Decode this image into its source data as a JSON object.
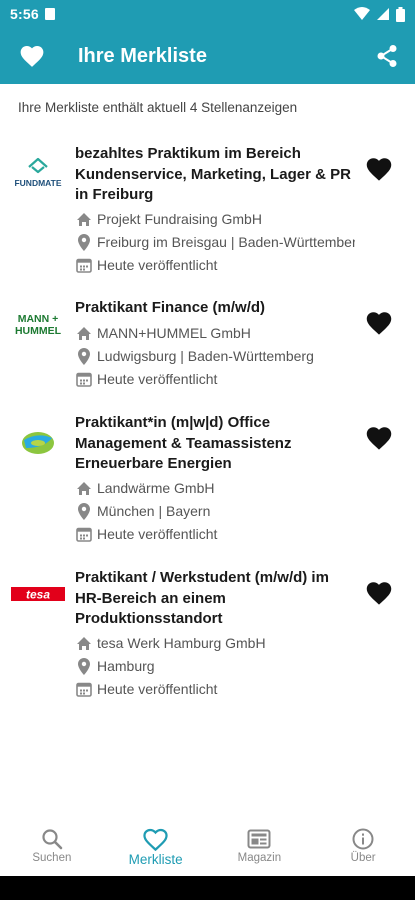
{
  "status": {
    "time": "5:56"
  },
  "app_bar": {
    "title": "Ihre Merkliste"
  },
  "summary": "Ihre Merkliste enthält aktuell 4 Stellenanzeigen",
  "jobs": [
    {
      "title": "bezahltes Praktikum im Bereich Kundenservice, Marketing, Lager & PR in Freiburg",
      "company": "Projekt Fundraising GmbH",
      "location": "Freiburg im Breisgau | Baden-Württemberg",
      "date": "Heute veröffentlicht",
      "logo_text": "FUNDMATE"
    },
    {
      "title": "Praktikant Finance (m/w/d)",
      "company": "MANN+HUMMEL GmbH",
      "location": "Ludwigsburg | Baden-Württemberg",
      "date": "Heute veröffentlicht",
      "logo_text": "MANN+ HUMMEL"
    },
    {
      "title": "Praktikant*in (m|w|d) Office Management & Teamassistenz Erneuerbare Energien",
      "company": "Landwärme GmbH",
      "location": "München | Bayern",
      "date": "Heute veröffentlicht",
      "logo_text": ""
    },
    {
      "title": "Praktikant / Werkstudent (m/w/d) im HR-Bereich an einem Produktionsstandort",
      "company": "tesa Werk Hamburg GmbH",
      "location": "Hamburg",
      "date": "Heute veröffentlicht",
      "logo_text": "tesa"
    }
  ],
  "nav": [
    {
      "label": "Suchen",
      "icon": "search-icon"
    },
    {
      "label": "Merkliste",
      "icon": "heart-outline-icon"
    },
    {
      "label": "Magazin",
      "icon": "newspaper-icon"
    },
    {
      "label": "Über",
      "icon": "info-icon"
    }
  ],
  "colors": {
    "primary": "#1f9cb3",
    "text": "#1a1a1a",
    "muted": "#555555"
  }
}
